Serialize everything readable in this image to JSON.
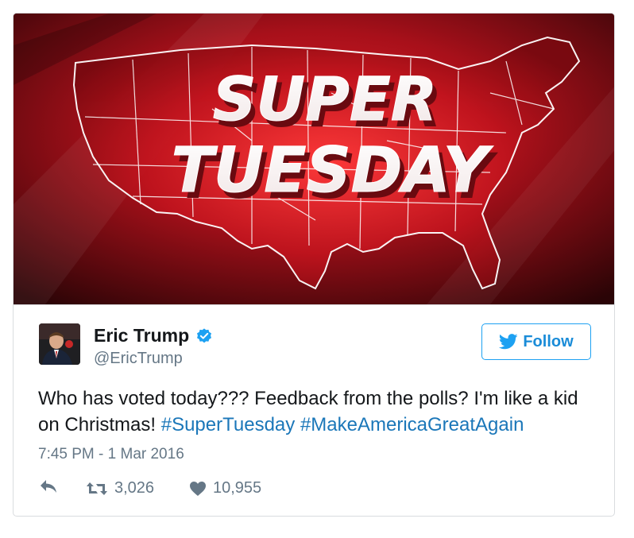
{
  "media": {
    "headline_line1": "SUPER",
    "headline_line2": "TUESDAY"
  },
  "author": {
    "display_name": "Eric Trump",
    "screen_name": "@EricTrump",
    "verified": true
  },
  "follow": {
    "label": "Follow"
  },
  "tweet": {
    "text_part1": "Who has voted today??? Feedback from the polls? I'm like a kid on Christmas! ",
    "hashtag1": "#SuperTuesday",
    "separator": " ",
    "hashtag2": "#MakeAmericaGreatAgain",
    "timestamp": "7:45 PM - 1 Mar 2016"
  },
  "stats": {
    "retweets": "3,026",
    "likes": "10,955"
  },
  "colors": {
    "twitter_blue": "#1da1f2",
    "hashtag_blue": "#1b77b9",
    "muted_gray": "#657786",
    "media_red": "#b3121a"
  },
  "icons": {
    "reply": "reply-icon",
    "retweet": "retweet-icon",
    "like": "heart-icon",
    "verified": "verified-badge-icon",
    "follow": "twitter-bird-icon"
  }
}
